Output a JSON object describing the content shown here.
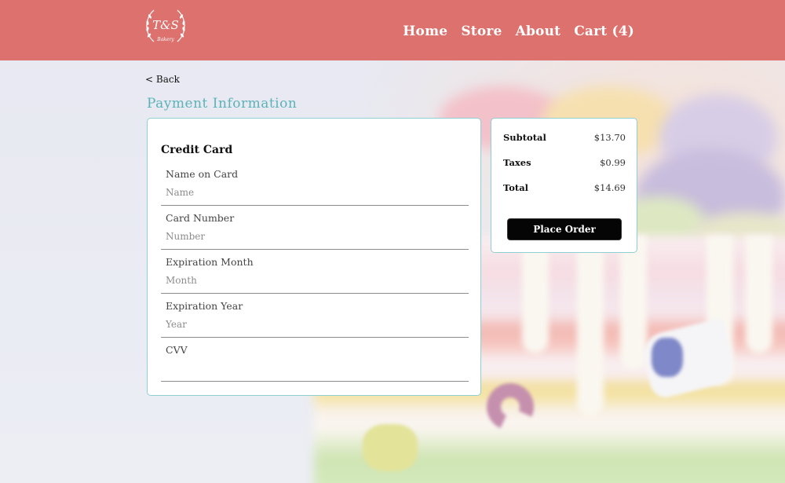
{
  "header": {
    "brand_initials": "T&S",
    "brand_text": "Bakery",
    "nav": [
      {
        "label": "Home"
      },
      {
        "label": "Store"
      },
      {
        "label": "About"
      },
      {
        "label": "Cart (4)"
      }
    ],
    "color": "#dc716e"
  },
  "back_link": "< Back",
  "page_title": "Payment Information",
  "payment": {
    "heading": "Credit Card",
    "fields": [
      {
        "label": "Name on Card",
        "placeholder": "Name",
        "value": ""
      },
      {
        "label": "Card Number",
        "placeholder": "Number",
        "value": ""
      },
      {
        "label": "Expiration Month",
        "placeholder": "Month",
        "value": ""
      },
      {
        "label": "Expiration Year",
        "placeholder": "Year",
        "value": ""
      },
      {
        "label": "CVV",
        "placeholder": "",
        "value": ""
      }
    ]
  },
  "summary": {
    "rows": [
      {
        "label": "Subtotal",
        "value": "$13.70"
      },
      {
        "label": "Taxes",
        "value": "$0.99"
      },
      {
        "label": "Total",
        "value": "$14.69"
      }
    ],
    "button_label": "Place Order"
  },
  "colors": {
    "accent": "#5bb3b8",
    "panel_border": "#8fcfd3",
    "button": "#050505"
  }
}
